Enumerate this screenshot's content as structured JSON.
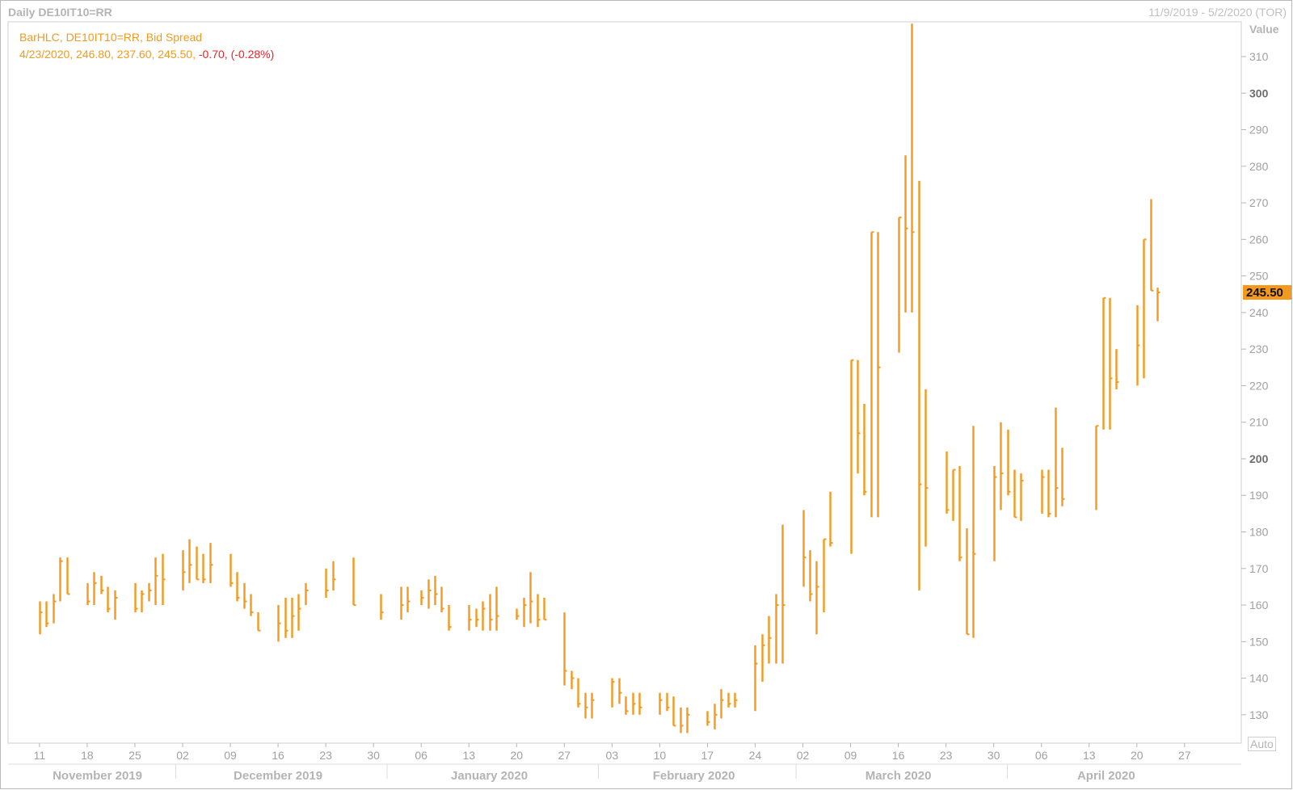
{
  "header": {
    "title": "Daily DE10IT10=RR",
    "date_range": "11/9/2019 - 5/2/2020 (TOR)"
  },
  "legend": {
    "line1": "BarHLC, DE10IT10=RR, Bid Spread",
    "line2_values": "4/23/2020, 246.80, 237.60, 245.50, ",
    "line2_change": "-0.70, (-0.28%)"
  },
  "axis": {
    "value_label": "Value",
    "last_price": "245.50",
    "auto_label": "Auto"
  },
  "colors": {
    "bar": "#f39a1e",
    "last_price_bg": "#f39a1e",
    "negative": "#e8242c",
    "grid_text": "#9a9a9a"
  },
  "chart_data": {
    "type": "bar",
    "style": "HLC",
    "ylim": [
      124,
      320
    ],
    "y_ticks": [
      130,
      140,
      150,
      160,
      170,
      180,
      190,
      200,
      210,
      220,
      230,
      240,
      250,
      260,
      270,
      280,
      290,
      300,
      310
    ],
    "y_major": [
      200,
      300
    ],
    "x_ticks": [
      {
        "label": "11",
        "date": "2019-11-11"
      },
      {
        "label": "18",
        "date": "2019-11-18"
      },
      {
        "label": "25",
        "date": "2019-11-25"
      },
      {
        "label": "02",
        "date": "2019-12-02"
      },
      {
        "label": "09",
        "date": "2019-12-09"
      },
      {
        "label": "16",
        "date": "2019-12-16"
      },
      {
        "label": "23",
        "date": "2019-12-23"
      },
      {
        "label": "30",
        "date": "2019-12-30"
      },
      {
        "label": "06",
        "date": "2020-01-06"
      },
      {
        "label": "13",
        "date": "2020-01-13"
      },
      {
        "label": "20",
        "date": "2020-01-20"
      },
      {
        "label": "27",
        "date": "2020-01-27"
      },
      {
        "label": "03",
        "date": "2020-02-03"
      },
      {
        "label": "10",
        "date": "2020-02-10"
      },
      {
        "label": "17",
        "date": "2020-02-17"
      },
      {
        "label": "24",
        "date": "2020-02-24"
      },
      {
        "label": "02",
        "date": "2020-03-02"
      },
      {
        "label": "09",
        "date": "2020-03-09"
      },
      {
        "label": "16",
        "date": "2020-03-16"
      },
      {
        "label": "23",
        "date": "2020-03-23"
      },
      {
        "label": "30",
        "date": "2020-03-30"
      },
      {
        "label": "06",
        "date": "2020-04-06"
      },
      {
        "label": "13",
        "date": "2020-04-13"
      },
      {
        "label": "20",
        "date": "2020-04-20"
      },
      {
        "label": "27",
        "date": "2020-04-27"
      }
    ],
    "months": [
      {
        "label": "November 2019",
        "start": "2019-11-09",
        "end": "2019-11-30"
      },
      {
        "label": "December 2019",
        "start": "2019-12-01",
        "end": "2019-12-31"
      },
      {
        "label": "January 2020",
        "start": "2020-01-01",
        "end": "2020-01-31"
      },
      {
        "label": "February 2020",
        "start": "2020-02-01",
        "end": "2020-02-29"
      },
      {
        "label": "March 2020",
        "start": "2020-03-01",
        "end": "2020-03-31"
      },
      {
        "label": "April 2020",
        "start": "2020-04-01",
        "end": "2020-04-30"
      }
    ],
    "x_range": [
      "2019-11-09",
      "2020-05-02"
    ],
    "bars": [
      {
        "date": "2019-11-11",
        "h": 161,
        "l": 152,
        "c": 158
      },
      {
        "date": "2019-11-12",
        "h": 161,
        "l": 154,
        "c": 155
      },
      {
        "date": "2019-11-13",
        "h": 163,
        "l": 155,
        "c": 161
      },
      {
        "date": "2019-11-14",
        "h": 173,
        "l": 161,
        "c": 172
      },
      {
        "date": "2019-11-15",
        "h": 173,
        "l": 163,
        "c": 163
      },
      {
        "date": "2019-11-18",
        "h": 166,
        "l": 160,
        "c": 161
      },
      {
        "date": "2019-11-19",
        "h": 169,
        "l": 160,
        "c": 166
      },
      {
        "date": "2019-11-20",
        "h": 168,
        "l": 163,
        "c": 164
      },
      {
        "date": "2019-11-21",
        "h": 165,
        "l": 158,
        "c": 159
      },
      {
        "date": "2019-11-22",
        "h": 164,
        "l": 156,
        "c": 162
      },
      {
        "date": "2019-11-25",
        "h": 166,
        "l": 158,
        "c": 159
      },
      {
        "date": "2019-11-26",
        "h": 164,
        "l": 158,
        "c": 163
      },
      {
        "date": "2019-11-27",
        "h": 166,
        "l": 161,
        "c": 164
      },
      {
        "date": "2019-11-28",
        "h": 173,
        "l": 160,
        "c": 168
      },
      {
        "date": "2019-11-29",
        "h": 174,
        "l": 160,
        "c": 167
      },
      {
        "date": "2019-12-02",
        "h": 175,
        "l": 164,
        "c": 169
      },
      {
        "date": "2019-12-03",
        "h": 178,
        "l": 166,
        "c": 171
      },
      {
        "date": "2019-12-04",
        "h": 176,
        "l": 167,
        "c": 167
      },
      {
        "date": "2019-12-05",
        "h": 174,
        "l": 166,
        "c": 167
      },
      {
        "date": "2019-12-06",
        "h": 177,
        "l": 166,
        "c": 171
      },
      {
        "date": "2019-12-09",
        "h": 174,
        "l": 165,
        "c": 166
      },
      {
        "date": "2019-12-10",
        "h": 169,
        "l": 161,
        "c": 162
      },
      {
        "date": "2019-12-11",
        "h": 166,
        "l": 159,
        "c": 161
      },
      {
        "date": "2019-12-12",
        "h": 163,
        "l": 157,
        "c": 158
      },
      {
        "date": "2019-12-13",
        "h": 158,
        "l": 153,
        "c": 153
      },
      {
        "date": "2019-12-16",
        "h": 160,
        "l": 150,
        "c": 155
      },
      {
        "date": "2019-12-17",
        "h": 162,
        "l": 151,
        "c": 153
      },
      {
        "date": "2019-12-18",
        "h": 162,
        "l": 151,
        "c": 157
      },
      {
        "date": "2019-12-19",
        "h": 163,
        "l": 153,
        "c": 159
      },
      {
        "date": "2019-12-20",
        "h": 166,
        "l": 160,
        "c": 164
      },
      {
        "date": "2019-12-23",
        "h": 170,
        "l": 162,
        "c": 164
      },
      {
        "date": "2019-12-24",
        "h": 172,
        "l": 164,
        "c": 167
      },
      {
        "date": "2019-12-27",
        "h": 173,
        "l": 160,
        "c": 160
      },
      {
        "date": "2019-12-31",
        "h": 163,
        "l": 156,
        "c": 158
      },
      {
        "date": "2020-01-03",
        "h": 165,
        "l": 156,
        "c": 160
      },
      {
        "date": "2020-01-04",
        "h": 165,
        "l": 158,
        "c": 161
      },
      {
        "date": "2020-01-06",
        "h": 164,
        "l": 160,
        "c": 162
      },
      {
        "date": "2020-01-07",
        "h": 167,
        "l": 159,
        "c": 164
      },
      {
        "date": "2020-01-08",
        "h": 168,
        "l": 160,
        "c": 163
      },
      {
        "date": "2020-01-09",
        "h": 165,
        "l": 158,
        "c": 159
      },
      {
        "date": "2020-01-10",
        "h": 160,
        "l": 153,
        "c": 154
      },
      {
        "date": "2020-01-13",
        "h": 160,
        "l": 153,
        "c": 156
      },
      {
        "date": "2020-01-14",
        "h": 159,
        "l": 154,
        "c": 156
      },
      {
        "date": "2020-01-15",
        "h": 161,
        "l": 153,
        "c": 159
      },
      {
        "date": "2020-01-16",
        "h": 163,
        "l": 153,
        "c": 156
      },
      {
        "date": "2020-01-17",
        "h": 165,
        "l": 153,
        "c": 157
      },
      {
        "date": "2020-01-20",
        "h": 159,
        "l": 156,
        "c": 157
      },
      {
        "date": "2020-01-21",
        "h": 162,
        "l": 154,
        "c": 160
      },
      {
        "date": "2020-01-22",
        "h": 169,
        "l": 155,
        "c": 161
      },
      {
        "date": "2020-01-23",
        "h": 163,
        "l": 154,
        "c": 156
      },
      {
        "date": "2020-01-24",
        "h": 162,
        "l": 156,
        "c": 156
      },
      {
        "date": "2020-01-27",
        "h": 158,
        "l": 138,
        "c": 142
      },
      {
        "date": "2020-01-28",
        "h": 142,
        "l": 137,
        "c": 140
      },
      {
        "date": "2020-01-29",
        "h": 140,
        "l": 132,
        "c": 133
      },
      {
        "date": "2020-01-30",
        "h": 136,
        "l": 129,
        "c": 132
      },
      {
        "date": "2020-01-31",
        "h": 136,
        "l": 129,
        "c": 134
      },
      {
        "date": "2020-02-03",
        "h": 140,
        "l": 132,
        "c": 139
      },
      {
        "date": "2020-02-04",
        "h": 140,
        "l": 133,
        "c": 136
      },
      {
        "date": "2020-02-05",
        "h": 135,
        "l": 130,
        "c": 131
      },
      {
        "date": "2020-02-06",
        "h": 136,
        "l": 130,
        "c": 133
      },
      {
        "date": "2020-02-07",
        "h": 136,
        "l": 130,
        "c": 132
      },
      {
        "date": "2020-02-10",
        "h": 136,
        "l": 130,
        "c": 134
      },
      {
        "date": "2020-02-11",
        "h": 136,
        "l": 131,
        "c": 132
      },
      {
        "date": "2020-02-12",
        "h": 135,
        "l": 127,
        "c": 127
      },
      {
        "date": "2020-02-13",
        "h": 132,
        "l": 125,
        "c": 127
      },
      {
        "date": "2020-02-14",
        "h": 132,
        "l": 125,
        "c": 130
      },
      {
        "date": "2020-02-17",
        "h": 131,
        "l": 127,
        "c": 128
      },
      {
        "date": "2020-02-18",
        "h": 133,
        "l": 126,
        "c": 130
      },
      {
        "date": "2020-02-19",
        "h": 137,
        "l": 129,
        "c": 134
      },
      {
        "date": "2020-02-20",
        "h": 136,
        "l": 132,
        "c": 133
      },
      {
        "date": "2020-02-21",
        "h": 136,
        "l": 132,
        "c": 134
      },
      {
        "date": "2020-02-24",
        "h": 149,
        "l": 131,
        "c": 144
      },
      {
        "date": "2020-02-25",
        "h": 152,
        "l": 139,
        "c": 149
      },
      {
        "date": "2020-02-26",
        "h": 157,
        "l": 144,
        "c": 151
      },
      {
        "date": "2020-02-27",
        "h": 163,
        "l": 144,
        "c": 160
      },
      {
        "date": "2020-02-28",
        "h": 182,
        "l": 144,
        "c": 160
      },
      {
        "date": "2020-03-02",
        "h": 186,
        "l": 165,
        "c": 173
      },
      {
        "date": "2020-03-03",
        "h": 175,
        "l": 161,
        "c": 163
      },
      {
        "date": "2020-03-04",
        "h": 172,
        "l": 152,
        "c": 165
      },
      {
        "date": "2020-03-05",
        "h": 178,
        "l": 158,
        "c": 178
      },
      {
        "date": "2020-03-06",
        "h": 191,
        "l": 176,
        "c": 177
      },
      {
        "date": "2020-03-09",
        "h": 227,
        "l": 174,
        "c": 227
      },
      {
        "date": "2020-03-10",
        "h": 227,
        "l": 196,
        "c": 207
      },
      {
        "date": "2020-03-11",
        "h": 215,
        "l": 190,
        "c": 191
      },
      {
        "date": "2020-03-12",
        "h": 262,
        "l": 184,
        "c": 262
      },
      {
        "date": "2020-03-13",
        "h": 262,
        "l": 184,
        "c": 225
      },
      {
        "date": "2020-03-16",
        "h": 266,
        "l": 229,
        "c": 266
      },
      {
        "date": "2020-03-17",
        "h": 283,
        "l": 240,
        "c": 263
      },
      {
        "date": "2020-03-18",
        "h": 319,
        "l": 240,
        "c": 262
      },
      {
        "date": "2020-03-19",
        "h": 276,
        "l": 164,
        "c": 193
      },
      {
        "date": "2020-03-20",
        "h": 219,
        "l": 176,
        "c": 192
      },
      {
        "date": "2020-03-23",
        "h": 202,
        "l": 185,
        "c": 186
      },
      {
        "date": "2020-03-24",
        "h": 197,
        "l": 183,
        "c": 197
      },
      {
        "date": "2020-03-25",
        "h": 198,
        "l": 172,
        "c": 173
      },
      {
        "date": "2020-03-26",
        "h": 181,
        "l": 152,
        "c": 152
      },
      {
        "date": "2020-03-27",
        "h": 209,
        "l": 151,
        "c": 174
      },
      {
        "date": "2020-03-30",
        "h": 198,
        "l": 172,
        "c": 195
      },
      {
        "date": "2020-03-31",
        "h": 210,
        "l": 186,
        "c": 196
      },
      {
        "date": "2020-04-01",
        "h": 208,
        "l": 190,
        "c": 191
      },
      {
        "date": "2020-04-02",
        "h": 197,
        "l": 184,
        "c": 184
      },
      {
        "date": "2020-04-03",
        "h": 196,
        "l": 183,
        "c": 194
      },
      {
        "date": "2020-04-06",
        "h": 197,
        "l": 185,
        "c": 195
      },
      {
        "date": "2020-04-07",
        "h": 197,
        "l": 184,
        "c": 185
      },
      {
        "date": "2020-04-08",
        "h": 214,
        "l": 184,
        "c": 192
      },
      {
        "date": "2020-04-09",
        "h": 203,
        "l": 187,
        "c": 189
      },
      {
        "date": "2020-04-14",
        "h": 209,
        "l": 186,
        "c": 209
      },
      {
        "date": "2020-04-15",
        "h": 244,
        "l": 208,
        "c": 244
      },
      {
        "date": "2020-04-16",
        "h": 244,
        "l": 208,
        "c": 222
      },
      {
        "date": "2020-04-17",
        "h": 230,
        "l": 219,
        "c": 221
      },
      {
        "date": "2020-04-20",
        "h": 242,
        "l": 220,
        "c": 231
      },
      {
        "date": "2020-04-21",
        "h": 260,
        "l": 222,
        "c": 260
      },
      {
        "date": "2020-04-22",
        "h": 271,
        "l": 246,
        "c": 246
      },
      {
        "date": "2020-04-23",
        "h": 246.8,
        "l": 237.6,
        "c": 245.5
      }
    ]
  }
}
